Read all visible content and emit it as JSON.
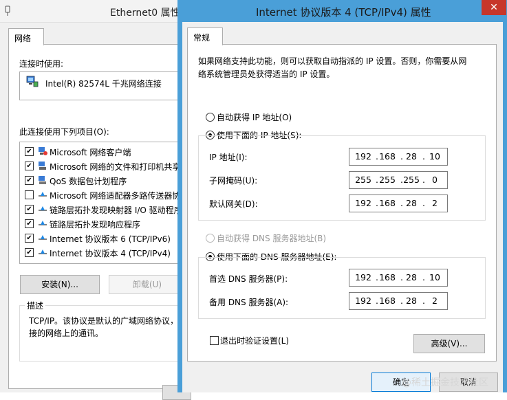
{
  "back_window": {
    "title": "Ethernet0 属性",
    "tab": "网络",
    "connect_label": "连接时使用:",
    "adapter_name": "Intel(R) 82574L 千兆网络连接",
    "items_label": "此连接使用下列项目(O):",
    "items": [
      {
        "label": "Microsoft 网络客户端",
        "checked": true,
        "icon": "network-client-icon"
      },
      {
        "label": "Microsoft 网络的文件和打印机共享",
        "checked": true,
        "icon": "file-share-icon"
      },
      {
        "label": "QoS 数据包计划程序",
        "checked": true,
        "icon": "qos-icon"
      },
      {
        "label": "Microsoft 网络适配器多路传送器协议",
        "checked": false,
        "icon": "protocol-icon"
      },
      {
        "label": "链路层拓扑发现映射器 I/O 驱动程序",
        "checked": true,
        "icon": "protocol-icon"
      },
      {
        "label": "链路层拓扑发现响应程序",
        "checked": true,
        "icon": "protocol-icon"
      },
      {
        "label": "Internet 协议版本 6 (TCP/IPv6)",
        "checked": true,
        "icon": "protocol-icon"
      },
      {
        "label": "Internet 协议版本 4 (TCP/IPv4)",
        "checked": true,
        "icon": "protocol-icon"
      }
    ],
    "install_button": "安装(N)...",
    "uninstall_button": "卸载(U)",
    "desc_legend": "描述",
    "desc_line1": "TCP/IP。该协议是默认的广域网络协议，",
    "desc_line2": "接的网络上的通讯。"
  },
  "dialog": {
    "title": "Internet 协议版本 4 (TCP/IPv4) 属性",
    "close_glyph": "✕",
    "tab": "常规",
    "intro_line1": "如果网络支持此功能，则可以获取自动指派的 IP 设置。否则，你需要从网",
    "intro_line2": "络系统管理员处获得适当的 IP 设置。",
    "auto_ip_label": "自动获得 IP 地址(O)",
    "manual_ip_label": "使用下面的 IP 地址(S):",
    "ip_mode": "manual",
    "ip_address": {
      "label": "IP 地址(I):",
      "octets": [
        "192",
        "168",
        "28",
        "10"
      ]
    },
    "subnet_mask": {
      "label": "子网掩码(U):",
      "octets": [
        "255",
        "255",
        "255",
        "0"
      ]
    },
    "gateway": {
      "label": "默认网关(D):",
      "octets": [
        "192",
        "168",
        "28",
        "2"
      ]
    },
    "auto_dns_label": "自动获得 DNS 服务器地址(B)",
    "manual_dns_label": "使用下面的 DNS 服务器地址(E):",
    "dns_mode": "manual",
    "preferred_dns": {
      "label": "首选 DNS 服务器(P):",
      "octets": [
        "192",
        "168",
        "28",
        "10"
      ]
    },
    "alternate_dns": {
      "label": "备用 DNS 服务器(A):",
      "octets": [
        "192",
        "168",
        "28",
        "2"
      ]
    },
    "validate_label": "退出时验证设置(L)",
    "validate_checked": false,
    "advanced_button": "高级(V)...",
    "ok_button": "确定",
    "cancel_button": "取消"
  },
  "watermark": "@稀土掘金技术社区",
  "colors": {
    "titlebar_active": "#4a9fd8",
    "close": "#c7362a",
    "ok_border": "#0078d7"
  }
}
